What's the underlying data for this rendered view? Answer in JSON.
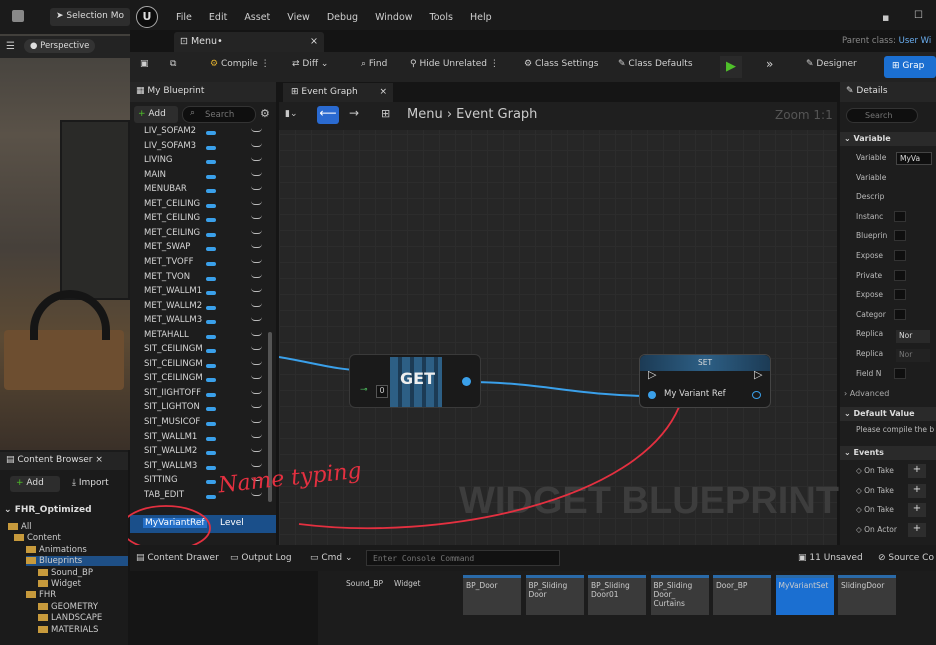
{
  "viewport": {
    "selection_mode": "Selection Mo",
    "perspective": "Perspective"
  },
  "menu": [
    "File",
    "Edit",
    "Asset",
    "View",
    "Debug",
    "Window",
    "Tools",
    "Help"
  ],
  "tab": {
    "name": "Menu•",
    "close": "×"
  },
  "parent_class": {
    "label": "Parent class:",
    "value": "User Wi"
  },
  "toolbar": {
    "compile": "Compile",
    "diff": "Diff",
    "find": "Find",
    "hide_unrelated": "Hide Unrelated",
    "class_settings": "Class Settings",
    "class_defaults": "Class Defaults",
    "designer": "Designer",
    "graph": "Grap"
  },
  "my_blueprint": {
    "title": "My Blueprint",
    "add": "Add",
    "search_placeholder": "Search",
    "variables": [
      "LIV_SOFAM2",
      "LIV_SOFAM3",
      "LIVING",
      "MAIN",
      "MENUBAR",
      "MET_CEILING",
      "MET_CEILING",
      "MET_CEILING",
      "MET_SWAP",
      "MET_TVOFF",
      "MET_TVON",
      "MET_WALLM1",
      "MET_WALLM2",
      "MET_WALLM3",
      "METAHALL",
      "SIT_CEILINGM",
      "SIT_CEILINGM",
      "SIT_CEILINGM",
      "SIT_IIGHTOFF",
      "SIT_LIGHTON",
      "SIT_MUSICOF",
      "SIT_WALLM1",
      "SIT_WALLM2",
      "SIT_WALLM3",
      "SITTING",
      "TAB_EDIT",
      "TAB_HIDE"
    ],
    "editing": "MyVariantRef",
    "editing_type": "Level"
  },
  "graph": {
    "tab": "Event Graph",
    "breadcrumb_root": "Menu",
    "breadcrumb_leaf": "Event Graph",
    "zoom": "Zoom 1:1",
    "watermark": "WIDGET BLUEPRINT"
  },
  "nodes": {
    "get_label": "GET",
    "get_index": "0",
    "set_label": "SET",
    "set_pin": "My Variant Ref"
  },
  "annotation": "Name typing",
  "details": {
    "title": "Details",
    "search_placeholder": "Search",
    "variable_section": "Variable",
    "rows": [
      "Variable",
      "Variable",
      "Descrip",
      "Instanc",
      "Blueprin",
      "Expose",
      "Private",
      "Expose",
      "Categor",
      "Replica",
      "Replica",
      "Field N"
    ],
    "var_name": "MyVa",
    "replica1": "Nor",
    "replica2": "Nor",
    "advanced": "Advanced",
    "default_value": "Default Value",
    "compile_hint": "Please compile the b",
    "events": "Events",
    "event_rows": [
      "On Take",
      "On Take",
      "On Take",
      "On Actor"
    ]
  },
  "content_browser": {
    "title": "Content Browser",
    "add": "Add",
    "import": "Import",
    "root": "FHR_Optimized",
    "tree": [
      "All",
      "Content",
      "Animations",
      "Blueprints",
      "Sound_BP",
      "Widget",
      "FHR",
      "GEOMETRY",
      "LANDSCAPE",
      "MATERIALS"
    ]
  },
  "bottom": {
    "content_drawer": "Content Drawer",
    "output_log": "Output Log",
    "cmd": "Cmd",
    "console_placeholder": "Enter Console Command",
    "unsaved": "11 Unsaved",
    "source": "Source Co"
  },
  "assets": [
    "Sound_BP",
    "Widget",
    "BP_Door",
    "BP_Sliding Door",
    "BP_Sliding Door01",
    "BP_Sliding Door_ Curtains",
    "Door_BP",
    "MyVariantSet",
    "SlidingDoor"
  ]
}
